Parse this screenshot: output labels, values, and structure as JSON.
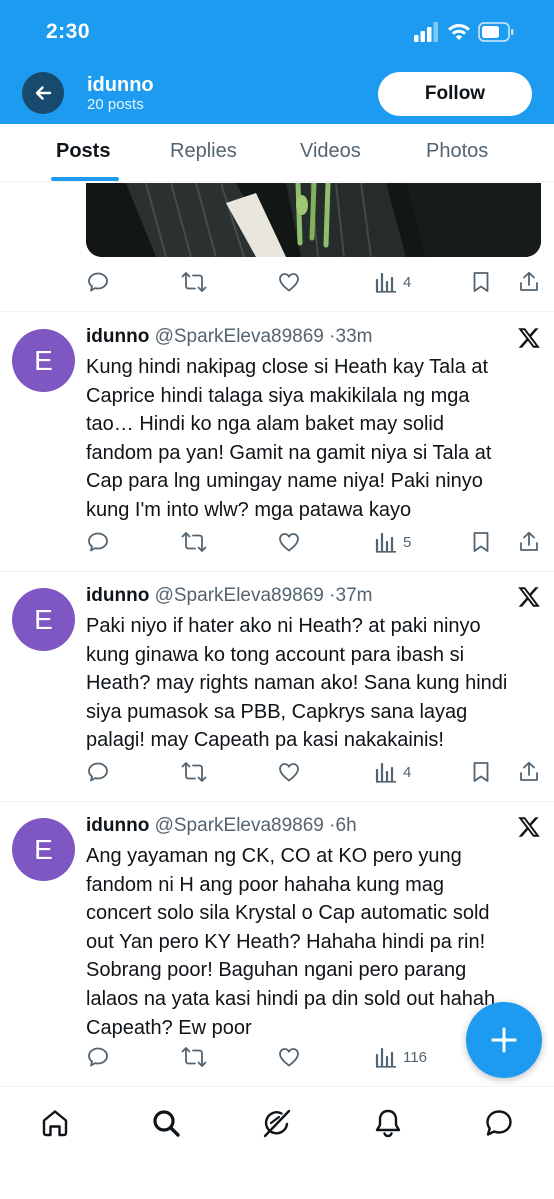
{
  "status_bar": {
    "time": "2:30"
  },
  "header": {
    "profile_name": "idunno",
    "posts_count": "20 posts",
    "follow_label": "Follow",
    "back_icon": "arrow-left-icon"
  },
  "tabs": [
    {
      "label": "Posts",
      "active": true
    },
    {
      "label": "Replies",
      "active": false
    },
    {
      "label": "Videos",
      "active": false
    },
    {
      "label": "Photos",
      "active": false
    }
  ],
  "partial_post": {
    "views": "4"
  },
  "tweets": [
    {
      "avatar_letter": "E",
      "name": "idunno",
      "handle": "@SparkEleva89869",
      "time": "33m",
      "text": "Kung hindi nakipag close si Heath kay Tala at\nCaprice hindi talaga siya makikilala ng mga\ntao… Hindi ko nga alam baket may solid\nfandom pa yan! Gamit na gamit niya si Tala at\nCap para lng umingay name niya! Paki ninyo\nkung I'm into wlw? mga patawa kayo",
      "views": "5"
    },
    {
      "avatar_letter": "E",
      "name": "idunno",
      "handle": "@SparkEleva89869",
      "time": "37m",
      "text": "Paki niyo if hater ako ni Heath? at paki ninyo\nkung ginawa ko tong account para ibash si\nHeath? may rights naman ako! Sana kung hindi\nsiya pumasok sa PBB, Capkrys sana layag\npalagi! may Capeath pa kasi nakakainis!",
      "views": "4"
    },
    {
      "avatar_letter": "E",
      "name": "idunno",
      "handle": "@SparkEleva89869",
      "time": "6h",
      "text": "Ang yayaman ng CK, CO at KO pero yung\nfandom ni H ang poor hahaha kung mag\nconcert solo sila Krystal o Cap automatic sold\nout Yan pero KY Heath? Hahaha hindi pa rin!\nSobrang poor! Baguhan ngani pero parang\nlalaos na yata kasi hindi pa din sold out hahah.\nCapeath? Ew poor",
      "views": "116"
    }
  ],
  "colors": {
    "accent": "#1d9bf0",
    "avatar": "#7e57c2",
    "secondary_text": "#536471"
  },
  "icons": {
    "reply": "reply-icon",
    "repost": "repost-icon",
    "like": "heart-icon",
    "views": "views-icon",
    "bookmark": "bookmark-icon",
    "share": "share-icon",
    "compose": "plus-icon",
    "nav": [
      "home-icon",
      "search-icon",
      "grok-icon",
      "notifications-icon",
      "messages-icon"
    ]
  }
}
